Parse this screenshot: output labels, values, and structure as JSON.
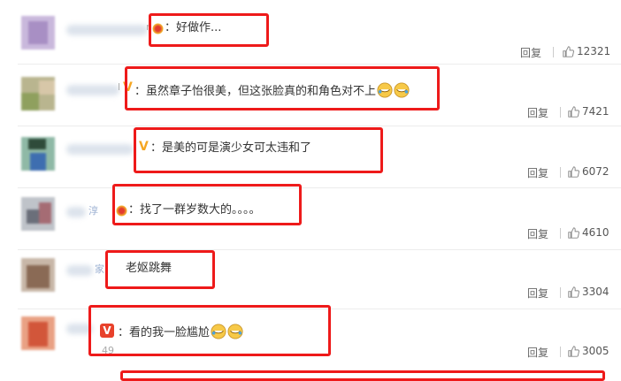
{
  "comments": [
    {
      "text": "：好做作...",
      "reply": "回复",
      "likes": "12321",
      "badge": "sun"
    },
    {
      "text": "：虽然章子怡很美，但这张脸真的和角色对不上",
      "reply": "回复",
      "likes": "7421",
      "badge": "v",
      "emoji_count": 2
    },
    {
      "text": "：是美的可是演少女可太违和了",
      "reply": "回复",
      "likes": "6072",
      "badge": "v"
    },
    {
      "text": "：找了一群岁数大的。。。。",
      "reply": "回复",
      "likes": "4610",
      "badge": "sun"
    },
    {
      "text": "老妪跳舞",
      "reply": "回复",
      "likes": "3304",
      "badge": "none"
    },
    {
      "text": "：看的我一脸尴尬",
      "reply": "回复",
      "likes": "3005",
      "badge": "v-red",
      "emoji_count": 2
    }
  ],
  "partial_names": {
    "row1": "n",
    "row2": "l",
    "row4": "淳",
    "row5": "家",
    "row6": "49"
  },
  "colors": {
    "highlight": "#ee1a1a",
    "v_badge": "#f5a623",
    "v_badge_red": "#e8412b"
  }
}
